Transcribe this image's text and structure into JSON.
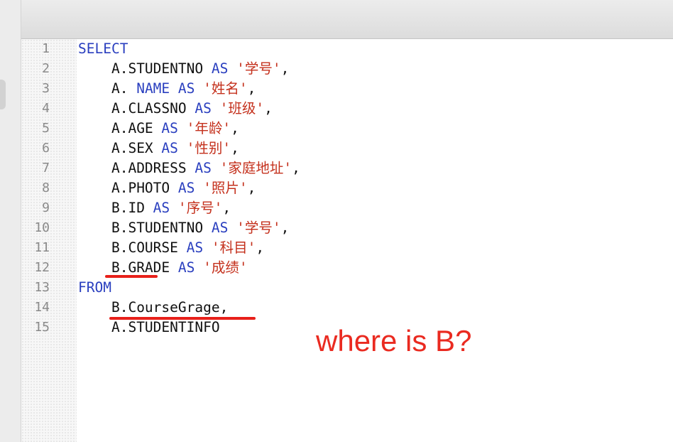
{
  "editor": {
    "lines": [
      {
        "num": "1",
        "indent": "",
        "tokens": [
          {
            "t": "SELECT",
            "c": "kw"
          }
        ]
      },
      {
        "num": "2",
        "indent": "    ",
        "tokens": [
          {
            "t": "A.STUDENTNO ",
            "c": "id"
          },
          {
            "t": "AS",
            "c": "kw"
          },
          {
            "t": " ",
            "c": "id"
          },
          {
            "t": "'学号'",
            "c": "str"
          },
          {
            "t": ",",
            "c": "id"
          }
        ]
      },
      {
        "num": "3",
        "indent": "    ",
        "tokens": [
          {
            "t": "A. ",
            "c": "id"
          },
          {
            "t": "NAME AS",
            "c": "kw"
          },
          {
            "t": " ",
            "c": "id"
          },
          {
            "t": "'姓名'",
            "c": "str"
          },
          {
            "t": ",",
            "c": "id"
          }
        ]
      },
      {
        "num": "4",
        "indent": "    ",
        "tokens": [
          {
            "t": "A.CLASSNO ",
            "c": "id"
          },
          {
            "t": "AS",
            "c": "kw"
          },
          {
            "t": " ",
            "c": "id"
          },
          {
            "t": "'班级'",
            "c": "str"
          },
          {
            "t": ",",
            "c": "id"
          }
        ]
      },
      {
        "num": "5",
        "indent": "    ",
        "tokens": [
          {
            "t": "A.AGE ",
            "c": "id"
          },
          {
            "t": "AS",
            "c": "kw"
          },
          {
            "t": " ",
            "c": "id"
          },
          {
            "t": "'年龄'",
            "c": "str"
          },
          {
            "t": ",",
            "c": "id"
          }
        ]
      },
      {
        "num": "6",
        "indent": "    ",
        "tokens": [
          {
            "t": "A.SEX ",
            "c": "id"
          },
          {
            "t": "AS",
            "c": "kw"
          },
          {
            "t": " ",
            "c": "id"
          },
          {
            "t": "'性别'",
            "c": "str"
          },
          {
            "t": ",",
            "c": "id"
          }
        ]
      },
      {
        "num": "7",
        "indent": "    ",
        "tokens": [
          {
            "t": "A.ADDRESS ",
            "c": "id"
          },
          {
            "t": "AS",
            "c": "kw"
          },
          {
            "t": " ",
            "c": "id"
          },
          {
            "t": "'家庭地址'",
            "c": "str"
          },
          {
            "t": ",",
            "c": "id"
          }
        ]
      },
      {
        "num": "8",
        "indent": "    ",
        "tokens": [
          {
            "t": "A.PHOTO ",
            "c": "id"
          },
          {
            "t": "AS",
            "c": "kw"
          },
          {
            "t": " ",
            "c": "id"
          },
          {
            "t": "'照片'",
            "c": "str"
          },
          {
            "t": ",",
            "c": "id"
          }
        ]
      },
      {
        "num": "9",
        "indent": "    ",
        "tokens": [
          {
            "t": "B.ID ",
            "c": "id"
          },
          {
            "t": "AS",
            "c": "kw"
          },
          {
            "t": " ",
            "c": "id"
          },
          {
            "t": "'序号'",
            "c": "str"
          },
          {
            "t": ",",
            "c": "id"
          }
        ]
      },
      {
        "num": "10",
        "indent": "    ",
        "tokens": [
          {
            "t": "B.STUDENTNO ",
            "c": "id"
          },
          {
            "t": "AS",
            "c": "kw"
          },
          {
            "t": " ",
            "c": "id"
          },
          {
            "t": "'学号'",
            "c": "str"
          },
          {
            "t": ",",
            "c": "id"
          }
        ]
      },
      {
        "num": "11",
        "indent": "    ",
        "tokens": [
          {
            "t": "B.COURSE ",
            "c": "id"
          },
          {
            "t": "AS",
            "c": "kw"
          },
          {
            "t": " ",
            "c": "id"
          },
          {
            "t": "'科目'",
            "c": "str"
          },
          {
            "t": ",",
            "c": "id"
          }
        ]
      },
      {
        "num": "12",
        "indent": "    ",
        "tokens": [
          {
            "t": "B.GRADE ",
            "c": "id"
          },
          {
            "t": "AS",
            "c": "kw"
          },
          {
            "t": " ",
            "c": "id"
          },
          {
            "t": "'成绩'",
            "c": "str"
          }
        ]
      },
      {
        "num": "13",
        "indent": "",
        "tokens": [
          {
            "t": "FROM",
            "c": "kw"
          }
        ]
      },
      {
        "num": "14",
        "indent": "    ",
        "tokens": [
          {
            "t": "B.CourseGrage,",
            "c": "id"
          }
        ]
      },
      {
        "num": "15",
        "indent": "    ",
        "tokens": [
          {
            "t": "A.STUDENTINFO",
            "c": "id"
          }
        ]
      }
    ]
  },
  "annotation": {
    "note": "where is B?",
    "color": "#ea2a20"
  },
  "colors": {
    "keyword": "#2a3fbf",
    "string": "#c4301c",
    "identifier": "#111111"
  }
}
